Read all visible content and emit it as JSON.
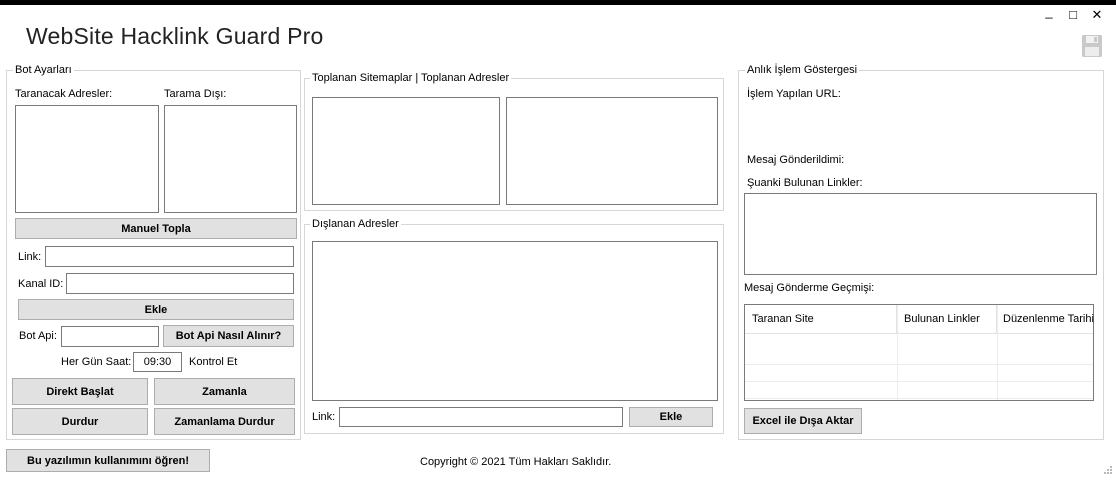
{
  "app": {
    "title": "WebSite Hacklink Guard Pro"
  },
  "window": {
    "minimize": "_",
    "maximize": "□",
    "close": "✕"
  },
  "bot_settings": {
    "legend": "Bot Ayarları",
    "scan_addresses_label": "Taranacak Adresler:",
    "scan_exclude_label": "Tarama Dışı:",
    "manual_collect_button": "Manuel Topla",
    "link_label": "Link:",
    "link_value": "",
    "channel_id_label": "Kanal ID:",
    "channel_id_value": "",
    "add_button": "Ekle",
    "bot_api_label": "Bot Api:",
    "bot_api_value": "",
    "bot_api_help_button": "Bot Api Nasıl Alınır?",
    "daily_time_label": "Her Gün Saat:",
    "time_value": "09:30",
    "check_label": "Kontrol Et",
    "start_now_button": "Direkt Başlat",
    "schedule_button": "Zamanla",
    "stop_button": "Durdur",
    "stop_schedule_button": "Zamanlama Durdur"
  },
  "collected": {
    "legend": "Toplanan Sitemaplar | Toplanan Adresler"
  },
  "excluded": {
    "legend": "Dışlanan Adresler",
    "link_label": "Link:",
    "link_value": "",
    "add_button": "Ekle"
  },
  "live": {
    "legend": "Anlık İşlem Göstergesi",
    "processed_url_label": "İşlem Yapılan URL:",
    "message_sent_label": "Mesaj Gönderildimi:",
    "current_links_label": "Şuanki Bulunan Linkler:",
    "history_label": "Mesaj Gönderme Geçmişi:",
    "table": {
      "columns": [
        "Taranan Site",
        "Bulunan Linkler",
        "Düzenlenme Tarihi"
      ],
      "rows": [
        [
          "",
          "",
          ""
        ],
        [
          "",
          "",
          ""
        ],
        [
          "",
          "",
          ""
        ],
        [
          "",
          "",
          ""
        ]
      ]
    },
    "export_button": "Excel ile Dışa Aktar"
  },
  "footer": {
    "learn_button": "Bu yazılımın kullanımını öğren!",
    "copyright": "Copyright © 2021 Tüm Hakları Saklıdır."
  },
  "icons": {
    "save": "floppy-disk-icon",
    "grip": "resize-grip-icon"
  }
}
